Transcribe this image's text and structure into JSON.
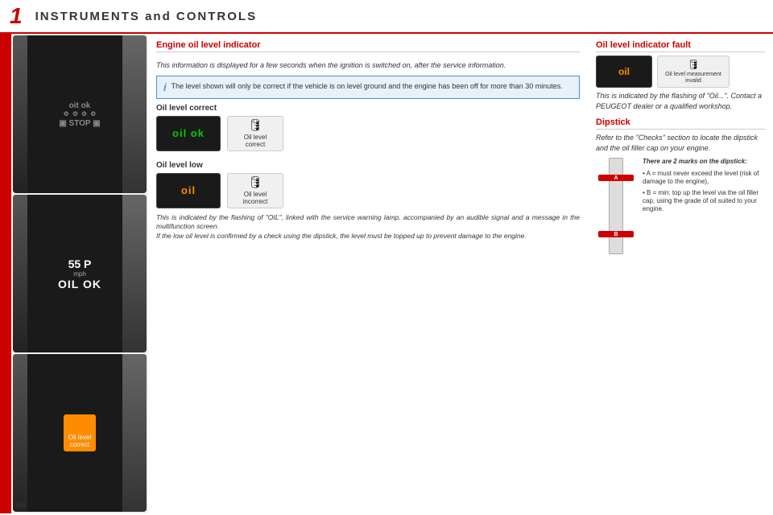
{
  "header": {
    "number": "1",
    "title": "INSTRUMENTS and CONTROLS"
  },
  "left_section": {
    "title": "Engine oil level indicator"
  },
  "panels": [
    {
      "id": "panel1",
      "display_top": "oit ok",
      "display_row2": "🔧 🔧 🔧 🔧",
      "display_row3": "STOP"
    },
    {
      "id": "panel2",
      "speed": "55 P",
      "speed_unit": "mph",
      "label": "OIL OK"
    },
    {
      "id": "panel3",
      "oil_icon": "🛢",
      "label1": "Oil level",
      "label2": "correct"
    }
  ],
  "intro": {
    "text": "This information is displayed for a few seconds when the ignition is switched on, after the service information."
  },
  "info_box": {
    "icon": "i",
    "text": "The level shown will only be correct if the vehicle is on level ground and the engine has been off for more than 30 minutes."
  },
  "oil_correct": {
    "title": "Oil level correct",
    "screen_text": "oil ok",
    "label1": "Oil level",
    "label2": "correct"
  },
  "oil_low": {
    "title": "Oil level low",
    "screen_text": "oil",
    "label1": "Oil level",
    "label2": "incorrect",
    "description": "This is indicated by the flashing of \"OIL\", linked with the service warning lamp, accompanied by an audible signal and a message in the multifunction screen.\nIf the low oil level is confirmed by a check using the dipstick, the level must be topped up to prevent damage to the engine."
  },
  "right_section": {
    "fault_title": "Oil level indicator fault",
    "fault_screen_text": "oil",
    "fault_label_line1": "Oil level measurement",
    "fault_label_line2": "invalid",
    "fault_description": "This is indicated by the flashing of \"Oil...\". Contact a PEUGEOT dealer or a qualified workshop.",
    "dipstick_title": "Dipstick",
    "dipstick_intro": "Refer to the \"Checks\" section to locate the dipstick and the oil filler cap on your engine.",
    "dipstick_marks": "There are 2 marks on the dipstick:",
    "mark_a": "A",
    "mark_b": "B",
    "mark_a_desc": "A = must never exceed the level (risk of damage to the engine),",
    "mark_b_desc": "B = min: top up the level via the oil filler cap, using the grade of oil suited to your engine."
  },
  "page_number": "48"
}
